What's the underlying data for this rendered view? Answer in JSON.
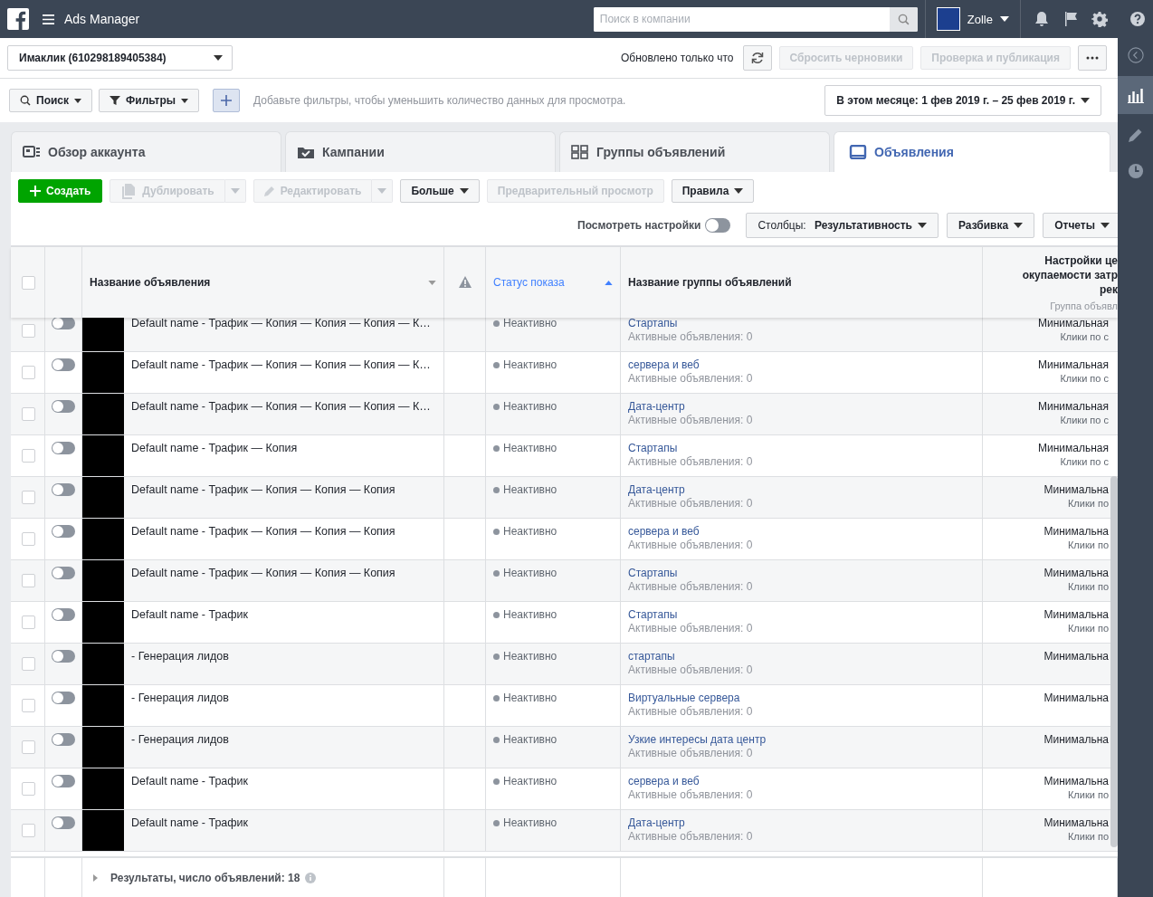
{
  "topbar": {
    "title": "Ads Manager",
    "search": {
      "placeholder": "Поиск в компании"
    },
    "user": "Zolle"
  },
  "account": {
    "name": "Имаклик (610298189405384)",
    "updated": "Обновлено только что",
    "buttons": [
      {
        "label": "Сбросить черновики",
        "disabled": true
      },
      {
        "label": "Проверка и публикация",
        "disabled": true
      }
    ]
  },
  "filters": {
    "search": "Поиск",
    "filters": "Фильтры",
    "hint": "Добавьте фильтры, чтобы уменьшить количество данных для просмотра.",
    "date": "В этом месяце: 1 фев 2019 г. – 25 фев 2019 г."
  },
  "tabs": [
    {
      "label": "Обзор аккаунта",
      "kind": "overview",
      "selected": false
    },
    {
      "label": "Кампании",
      "kind": "campaigns",
      "selected": false
    },
    {
      "label": "Группы объявлений",
      "kind": "adsets",
      "selected": false
    },
    {
      "label": "Объявления",
      "kind": "ads",
      "selected": true
    }
  ],
  "actions": [
    {
      "label": "Создать",
      "kind": "create",
      "disabled": false
    },
    {
      "label": "Дублировать",
      "kind": "duplicate",
      "disabled": true
    },
    {
      "label": "Редактировать",
      "kind": "edit",
      "disabled": true
    },
    {
      "label": "Больше",
      "kind": "menu",
      "disabled": false
    },
    {
      "label": "Предварительный просмотр",
      "kind": "plain",
      "disabled": true
    },
    {
      "label": "Правила",
      "kind": "menu",
      "disabled": false
    }
  ],
  "view": {
    "settings": {
      "label": "Посмотреть настройки",
      "on": false
    },
    "columns": {
      "label": "Столбцы:",
      "value": "Результативность"
    },
    "breakdown": "Разбивка",
    "reports": "Отчеты"
  },
  "table": {
    "all_selected": false,
    "columns": [
      {
        "label": "Название объявления",
        "sorted": false
      },
      {
        "label": "Статус показа",
        "sorted": true
      },
      {
        "label": "Название группы объявлений",
        "sorted": false
      }
    ],
    "last_column": {
      "lines": [
        "Настройки це",
        "окупаемости затр",
        "рек"
      ],
      "sub": "Группа объявл"
    },
    "rows": [
      {
        "selected": false,
        "on": false,
        "name": "Default name - Трафик — Копия — Копия — Копия — К…",
        "status": "Неактивно",
        "group": "Стартапы",
        "group_sub": "Активные объявления: 0",
        "bid": "Минимальная",
        "bid_sub": "Клики по с"
      },
      {
        "selected": false,
        "on": false,
        "name": "Default name - Трафик — Копия — Копия — Копия — К…",
        "status": "Неактивно",
        "group": "сервера и веб",
        "group_sub": "Активные объявления: 0",
        "bid": "Минимальная",
        "bid_sub": "Клики по с"
      },
      {
        "selected": false,
        "on": false,
        "name": "Default name - Трафик — Копия — Копия — Копия — К…",
        "status": "Неактивно",
        "group": "Дата-центр",
        "group_sub": "Активные объявления: 0",
        "bid": "Минимальная",
        "bid_sub": "Клики по с"
      },
      {
        "selected": false,
        "on": false,
        "name": "Default name - Трафик — Копия",
        "status": "Неактивно",
        "group": "Стартапы",
        "group_sub": "Активные объявления: 0",
        "bid": "Минимальная",
        "bid_sub": "Клики по с"
      },
      {
        "selected": false,
        "on": false,
        "name": "Default name - Трафик — Копия — Копия — Копия",
        "status": "Неактивно",
        "group": "Дата-центр",
        "group_sub": "Активные объявления: 0",
        "bid": "Минимальна",
        "bid_sub": "Клики по"
      },
      {
        "selected": false,
        "on": false,
        "name": "Default name - Трафик — Копия — Копия — Копия",
        "status": "Неактивно",
        "group": "сервера и веб",
        "group_sub": "Активные объявления: 0",
        "bid": "Минимальна",
        "bid_sub": "Клики по"
      },
      {
        "selected": false,
        "on": false,
        "name": "Default name - Трафик — Копия — Копия — Копия",
        "status": "Неактивно",
        "group": "Стартапы",
        "group_sub": "Активные объявления: 0",
        "bid": "Минимальна",
        "bid_sub": "Клики по"
      },
      {
        "selected": false,
        "on": false,
        "name": "Default name - Трафик",
        "status": "Неактивно",
        "group": "Стартапы",
        "group_sub": "Активные объявления: 0",
        "bid": "Минимальна",
        "bid_sub": "Клики по"
      },
      {
        "selected": false,
        "on": false,
        "name": "- Генерация лидов",
        "status": "Неактивно",
        "group": "стартапы",
        "group_sub": "Активные объявления: 0",
        "bid": "Минимальна"
      },
      {
        "selected": false,
        "on": false,
        "name": "- Генерация лидов",
        "status": "Неактивно",
        "group": "Виртуальные сервера",
        "group_sub": "Активные объявления: 0",
        "bid": "Минимальна"
      },
      {
        "selected": false,
        "on": false,
        "name": "- Генерация лидов",
        "status": "Неактивно",
        "group": "Узкие интересы дата центр",
        "group_sub": "Активные объявления: 0",
        "bid": "Минимальна"
      },
      {
        "selected": false,
        "on": false,
        "name": "Default name - Трафик",
        "status": "Неактивно",
        "group": "сервера и веб",
        "group_sub": "Активные объявления: 0",
        "bid": "Минимальна",
        "bid_sub": "Клики по"
      },
      {
        "selected": false,
        "on": false,
        "name": "Default name - Трафик",
        "status": "Неактивно",
        "group": "Дата-центр",
        "group_sub": "Активные объявления: 0",
        "bid": "Минимальна",
        "bid_sub": "Клики по"
      }
    ],
    "footer": "Результаты, число объявлений: 18"
  }
}
